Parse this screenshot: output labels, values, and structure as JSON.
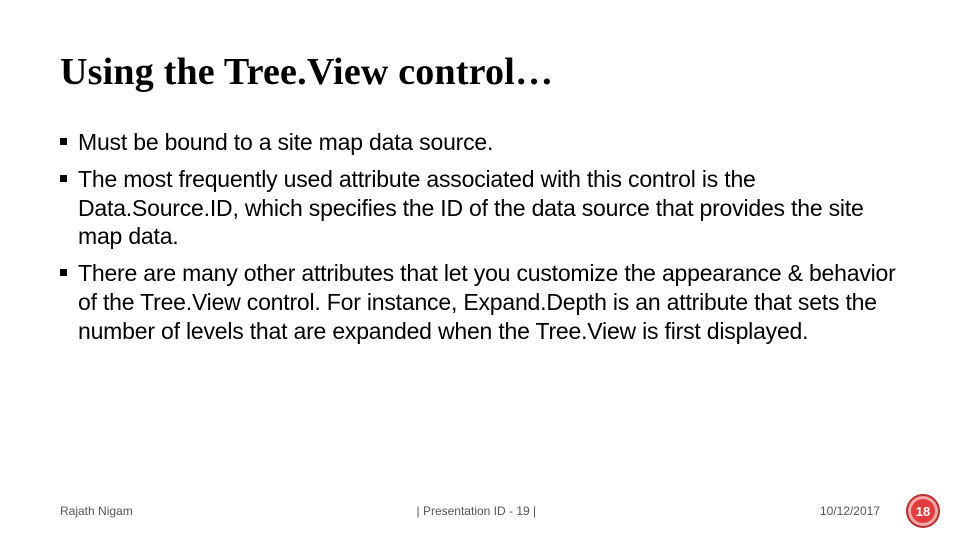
{
  "title": "Using the Tree.View control…",
  "bullets": [
    "Must be bound to a site map data source.",
    "The most frequently used attribute associated with this control is the Data.Source.ID, which specifies the ID of the data source that provides the site map data.",
    "There are many other attributes that let you customize the appearance & behavior of the Tree.View control. For instance, Expand.Depth is an attribute that sets the number of levels that are expanded when the Tree.View is first displayed."
  ],
  "footer": {
    "author": "Rajath Nigam",
    "center": "| Presentation ID - 19 |",
    "date": "10/12/2017",
    "page": "18"
  }
}
